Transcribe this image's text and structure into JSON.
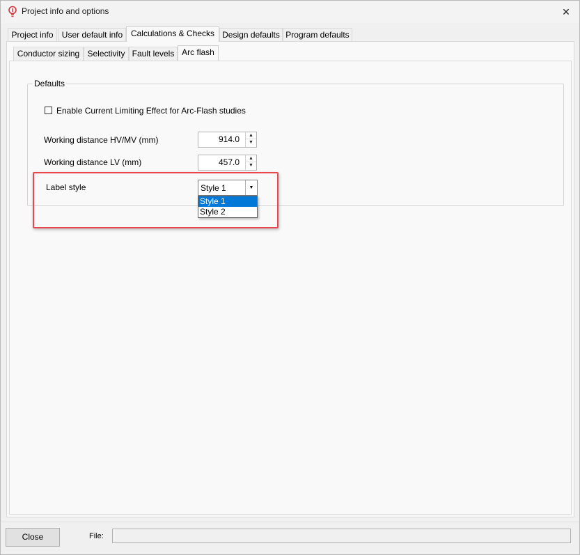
{
  "window": {
    "title": "Project info and options",
    "close_glyph": "✕",
    "icon": "lightbulb-icon",
    "icon_color": "#d13438"
  },
  "tabs_main": [
    {
      "label": "Project info",
      "active": false
    },
    {
      "label": "User default info",
      "active": false
    },
    {
      "label": "Calculations & Checks",
      "active": true
    },
    {
      "label": "Design defaults",
      "active": false
    },
    {
      "label": "Program defaults",
      "active": false
    }
  ],
  "tabs_sub": [
    {
      "label": "Conductor sizing",
      "active": false
    },
    {
      "label": "Selectivity",
      "active": false
    },
    {
      "label": "Fault levels",
      "active": false
    },
    {
      "label": "Arc flash",
      "active": true
    }
  ],
  "defaults": {
    "group_title": "Defaults",
    "enable_current_limiting_label": "Enable Current Limiting Effect for Arc-Flash studies",
    "enable_current_limiting_checked": false,
    "hv_mv_label": "Working distance HV/MV (mm)",
    "hv_mv_value": "914.0",
    "lv_label": "Working distance LV (mm)",
    "lv_value": "457.0",
    "label_style_label": "Label style",
    "label_style_value": "Style 1",
    "label_style_options": [
      "Style 1",
      "Style 2"
    ]
  },
  "highlight_color": "#e8474f",
  "accent_color": "#0078d7",
  "footer": {
    "close_label": "Close",
    "file_label": "File:",
    "file_value": ""
  }
}
